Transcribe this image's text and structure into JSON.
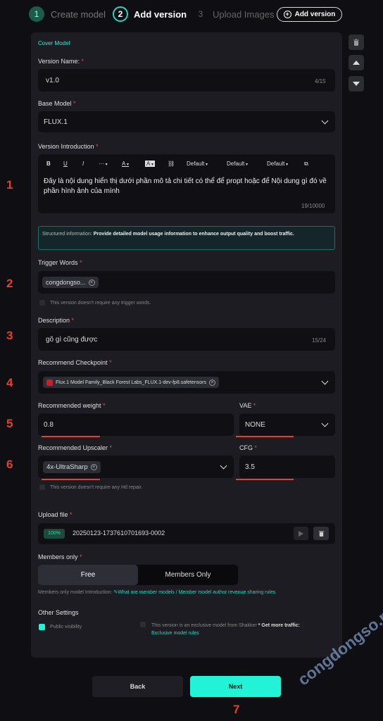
{
  "stepper": {
    "steps": [
      {
        "num": "1",
        "label": "Create model",
        "state": "done"
      },
      {
        "num": "2",
        "label": "Add version",
        "state": "active"
      },
      {
        "num": "3",
        "label": "Upload Images",
        "state": "todo"
      }
    ],
    "add_version_label": "Add version"
  },
  "form": {
    "section_title": "Cover Model",
    "version_name": {
      "label": "Version Name:",
      "value": "v1.0",
      "count": "4/15"
    },
    "base_model": {
      "label": "Base Model",
      "value": "FLUX.1"
    },
    "version_intro": {
      "label": "Version Introduction",
      "toolbar": {
        "bold": "B",
        "underline": "U",
        "italic": "I",
        "more": "···",
        "font_color": "A",
        "bg_color": "A",
        "default1": "Default",
        "default2": "Default",
        "default3": "Default"
      },
      "text": "Đây là nội dung hiển thị dưới phần mô tả chi tiết có thể để propt hoặc để Nội dung gì đó về phần hình ảnh của mình",
      "count": "19/10000"
    },
    "structured_info": {
      "prefix": "Structured information:",
      "text": "Provide detailed model usage information to enhance output quality and boost traffic."
    },
    "trigger_words": {
      "label": "Trigger Words",
      "chip": "congdongso...",
      "note": "This version doesn't require any trigger words."
    },
    "description": {
      "label": "Description",
      "value": "gõ gì cũng được",
      "count": "15/24"
    },
    "recommend_checkpoint": {
      "label": "Recommend Checkpoint",
      "chip": "Flux.1 Model Family_Black Forest Labs_FLUX.1-dev-fp8.safetensors"
    },
    "recommended_weight": {
      "label": "Recommended weight",
      "value": "0.8"
    },
    "vae": {
      "label": "VAE",
      "value": "NONE"
    },
    "recommended_upscaler": {
      "label": "Recommended Upscaler",
      "chip": "4x-UltraSharp",
      "note": "This version doesn't require any Hd repair."
    },
    "cfg": {
      "label": "CFG",
      "value": "3.5"
    },
    "upload_file": {
      "label": "Upload file",
      "progress": "100%",
      "progress_value": 1.0,
      "filename": "20250123-1737610701693-0002"
    },
    "members_only": {
      "label": "Members only",
      "options": [
        "Free",
        "Members Only"
      ],
      "selected": "Free",
      "intro_prefix": "Members only model Introduction:",
      "intro_link": "✎What are member models / Member model author revenue sharing rules"
    },
    "other_settings": {
      "label": "Other Settings",
      "public_visibility": "Public visibility",
      "public_visibility_checked": true,
      "exclusive_text": "This version is an exclusive model from Shakker",
      "exclusive_bold": "* Get more traffic:",
      "exclusive_link": "Exclusive model rules"
    }
  },
  "footer": {
    "back_label": "Back",
    "next_label": "Next"
  },
  "markers": [
    "1",
    "2",
    "3",
    "4",
    "5",
    "6",
    "7"
  ],
  "watermark": "congdongso.net",
  "colors": {
    "accent": "#22f2d6",
    "annotation": "#e3402d",
    "panel": "#1c1c22",
    "background": "#0f0f13"
  }
}
